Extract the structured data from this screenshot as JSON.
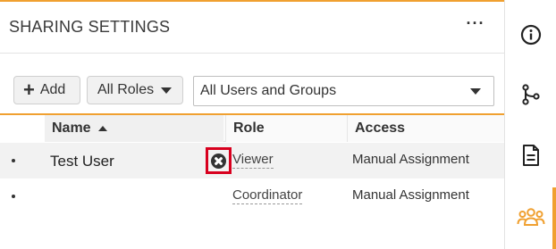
{
  "panel": {
    "title": "SHARING SETTINGS",
    "more_label": "···"
  },
  "toolbar": {
    "add_label": "Add",
    "roles_filter": "All Roles",
    "users_filter": "All Users and Groups"
  },
  "table": {
    "columns": {
      "name": "Name",
      "role": "Role",
      "access": "Access"
    },
    "sort": {
      "column": "Name",
      "direction": "ascending"
    },
    "rows": [
      {
        "name": "Test User",
        "role": "Viewer",
        "access": "Manual Assignment"
      },
      {
        "name": "",
        "role": "Coordinator",
        "access": "Manual Assignment"
      }
    ]
  },
  "sidebar": {
    "items": [
      {
        "icon": "info-icon"
      },
      {
        "icon": "branch-icon"
      },
      {
        "icon": "document-icon"
      },
      {
        "icon": "users-icon",
        "active": true
      }
    ]
  },
  "colors": {
    "accent": "#f0a030",
    "highlight_box": "#d8001e"
  }
}
